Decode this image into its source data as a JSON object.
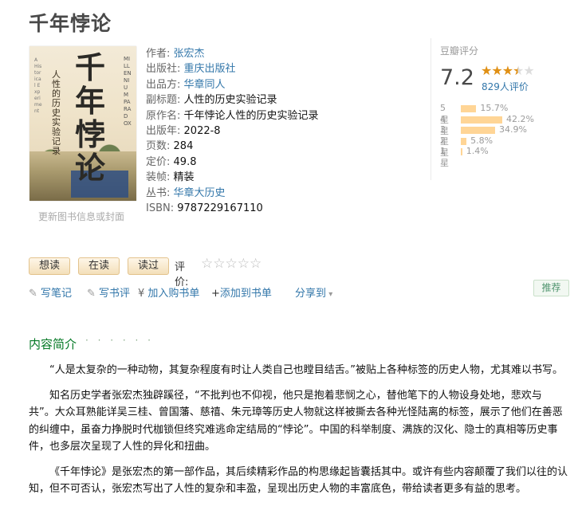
{
  "book": {
    "title": "千年悖论",
    "cover": {
      "big_text": "千年悖论",
      "sub_text": "人性的历史实验记录",
      "en_text": "MILLENNIUM PARADOX",
      "en_side": "A Historical Experiment"
    },
    "cover_link": "更新图书信息或封面"
  },
  "info": [
    {
      "label": "作者:",
      "value": "张宏杰",
      "link": true
    },
    {
      "label": "出版社:",
      "value": "重庆出版社",
      "link": true
    },
    {
      "label": "出品方:",
      "value": "华章同人",
      "link": true
    },
    {
      "label": "副标题:",
      "value": "人性的历史实验记录",
      "link": false
    },
    {
      "label": "原作名:",
      "value": "千年悖论人性的历史实验记录",
      "link": false
    },
    {
      "label": "出版年:",
      "value": "2022-8",
      "link": false
    },
    {
      "label": "页数:",
      "value": "284",
      "link": false
    },
    {
      "label": "定价:",
      "value": "49.8",
      "link": false
    },
    {
      "label": "装帧:",
      "value": "精装",
      "link": false
    },
    {
      "label": "丛书:",
      "value": "华章大历史",
      "link": true
    },
    {
      "label": "ISBN:",
      "value": "9787229167110",
      "link": false
    }
  ],
  "rating": {
    "header": "豆瓣评分",
    "score": "7.2",
    "stars_value": 3.5,
    "votes": "829人评价",
    "distribution": [
      {
        "label": "5星",
        "pct": "15.7%",
        "value": 15.7
      },
      {
        "label": "4星",
        "pct": "42.2%",
        "value": 42.2
      },
      {
        "label": "3星",
        "pct": "34.9%",
        "value": 34.9
      },
      {
        "label": "2星",
        "pct": "5.8%",
        "value": 5.8
      },
      {
        "label": "1星",
        "pct": "1.4%",
        "value": 1.4
      }
    ]
  },
  "actions": {
    "want": "想读",
    "reading": "在读",
    "read": "读过",
    "rate_label": "评价:"
  },
  "links": {
    "write_note": "写笔记",
    "write_review": "写书评",
    "add_cart": "加入购书单",
    "add_booklist": "添加到书单",
    "share": "分享到",
    "recommend": "推荐"
  },
  "intro": {
    "title": "内容简介",
    "dots": "· · · · · ·",
    "paragraphs": [
      "“人是太复杂的一种动物，其复杂程度有时让人类自己也瞠目结舌。”被贴上各种标签的历史人物，尤其难以书写。",
      "知名历史学者张宏杰独辟蹊径，“不批判也不仰视，他只是抱着悲悯之心，替他笔下的人物设身处地，悲欢与共”。大众耳熟能详吴三桂、曾国藩、慈禧、朱元璋等历史人物就这样被撕去各种光怪陆离的标签，展示了他们在善恶的纠缠中，虽奋力挣脱时代枷锁但终究难逃命定结局的“悖论”。中国的科举制度、满族的汉化、隐士的真相等历史事件，也多层次呈现了人性的异化和扭曲。",
      "《千年悖论》是张宏杰的第一部作品，其后续精彩作品的构思缘起皆囊括其中。或许有些内容颠覆了我们以往的认知，但不可否认，张宏杰写出了人性的复杂和丰盈，呈现出历史人物的丰富底色，带给读者更多有益的思考。"
    ]
  }
}
